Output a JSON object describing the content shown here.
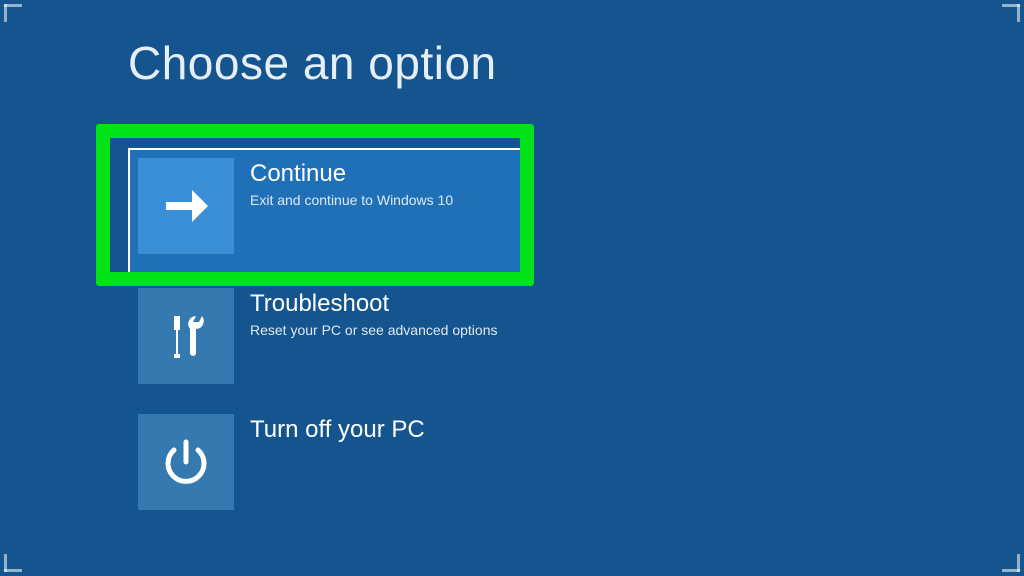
{
  "title": "Choose an option",
  "options": {
    "continue": {
      "label": "Continue",
      "desc": "Exit and continue to Windows 10"
    },
    "troubleshoot": {
      "label": "Troubleshoot",
      "desc": "Reset your PC or see advanced options"
    },
    "poweroff": {
      "label": "Turn off your PC",
      "desc": ""
    }
  },
  "annotation": {
    "highlight_color": "#00e318",
    "selected_option": "continue"
  },
  "colors": {
    "background": "#14558f",
    "tile_selected": "#1f70b7",
    "icon_bg_selected": "#3a8fd6",
    "icon_bg": "#3479af"
  }
}
